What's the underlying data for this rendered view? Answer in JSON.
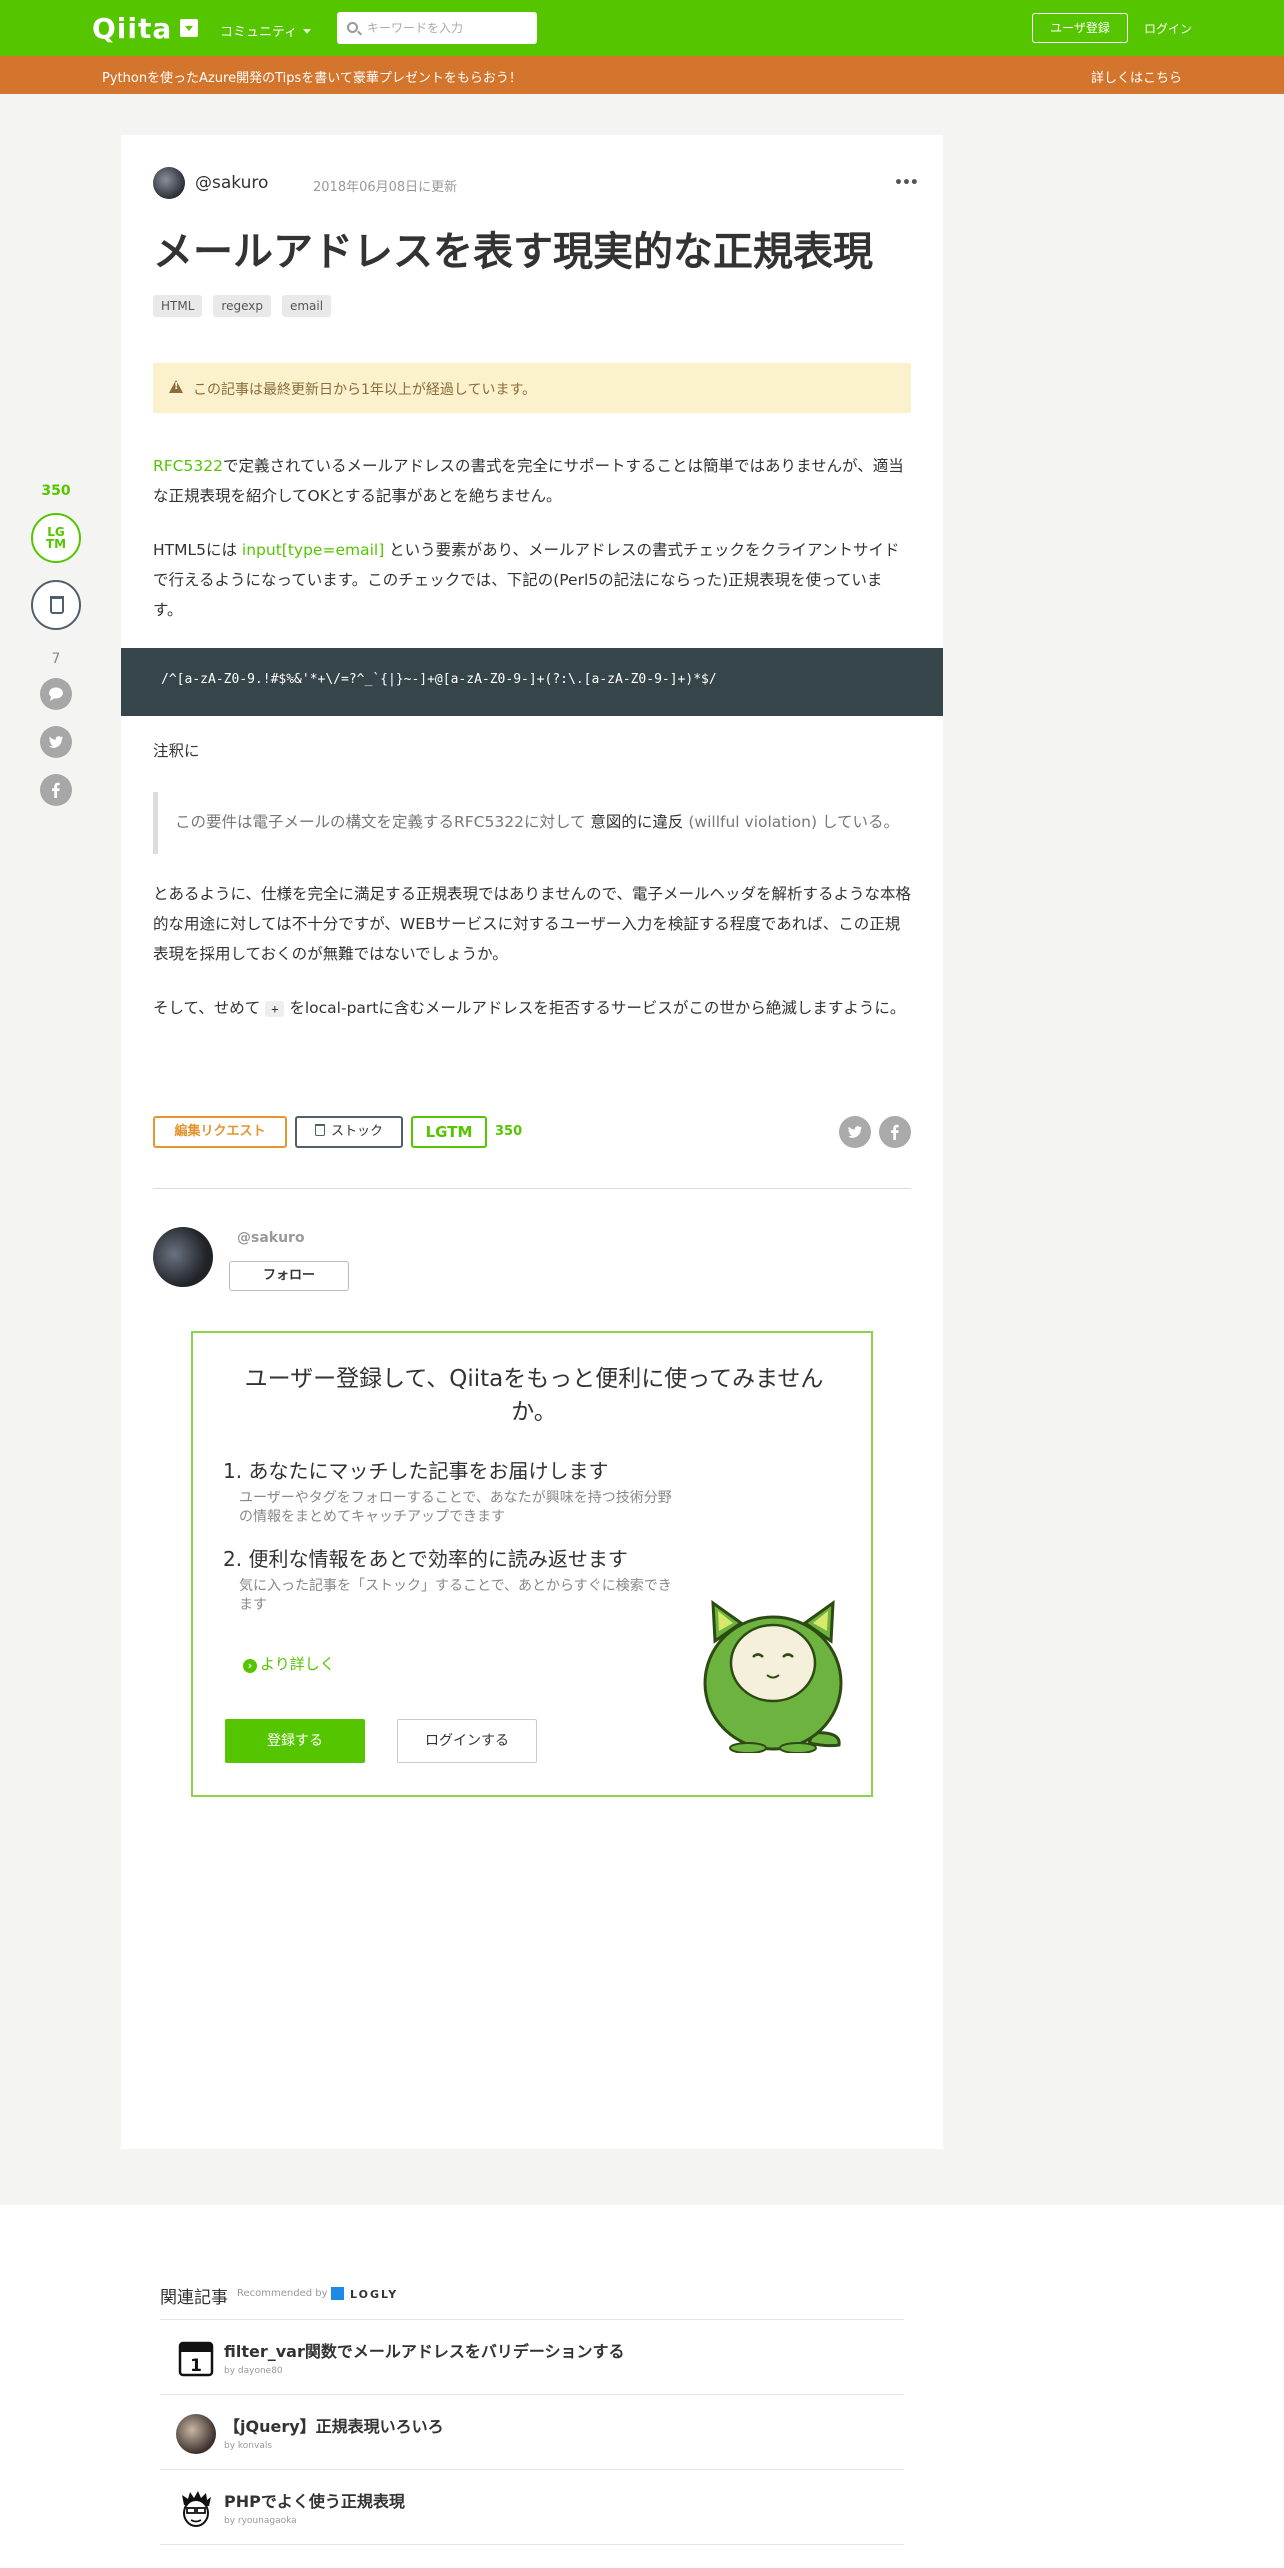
{
  "header": {
    "logo": "Qiita",
    "community": "コミュニティ",
    "search_placeholder": "キーワードを入力",
    "signup": "ユーザ登録",
    "login": "ログイン"
  },
  "banner": {
    "text": "Pythonを使ったAzure開発のTipsを書いて豪華プレゼントをもらおう！",
    "link": "詳しくはこちら"
  },
  "side": {
    "lgtm_count": "350",
    "lgtm_label": "LGTM",
    "comment_count": "7"
  },
  "article": {
    "author": "@sakuro",
    "date": "2018年06月08日に更新",
    "title": "メールアドレスを表す現実的な正規表現",
    "tags": [
      "HTML",
      "regexp",
      "email"
    ],
    "warning": "この記事は最終更新日から1年以上が経過しています。",
    "p1_link": "RFC5322",
    "p1_rest": "で定義されているメールアドレスの書式を完全にサポートすることは簡単ではありませんが、適当な正規表現を紹介してOKとする記事があとを絶ちません。",
    "p2_pre": "HTML5には ",
    "p2_link": "input[type=email]",
    "p2_rest": " という要素があり、メールアドレスの書式チェックをクライアントサイドで行えるようになっています。このチェックでは、下記の(Perl5の記法にならった)正規表現を使っています。",
    "code": "/^[a-zA-Z0-9.!#$%&'*+\\/=?^_`{|}~-]+@[a-zA-Z0-9-]+(?:\\.[a-zA-Z0-9-]+)*$/",
    "p3": "注釈に",
    "quote_pre": "この要件は電子メールの構文を定義するRFC5322に対して ",
    "quote_strong": "意図的に違反",
    "quote_post": " (willful violation) している。",
    "p4": "とあるように、仕様を完全に満足する正規表現ではありませんので、電子メールヘッダを解析するような本格的な用途に対しては不十分ですが、WEBサービスに対するユーザー入力を検証する程度であれば、この正規表現を採用しておくのが無難ではないでしょうか。",
    "p5_pre": "そして、せめて ",
    "p5_code": "+",
    "p5_rest": " をlocal-partに含むメールアドレスを拒否するサービスがこの世から絶滅しますように。"
  },
  "actions": {
    "edit": "編集リクエスト",
    "stock": "ストック",
    "lgtm": "LGTM",
    "lgtm_count": "350"
  },
  "author_box": {
    "name": "@sakuro",
    "follow": "フォロー"
  },
  "register": {
    "title": "ユーザー登録して、Qiitaをもっと便利に使ってみませんか。",
    "items": [
      {
        "heading": "1. あなたにマッチした記事をお届けします",
        "desc": "ユーザーやタグをフォローすることで、あなたが興味を持つ技術分野の情報をまとめてキャッチアップできます"
      },
      {
        "heading": "2. 便利な情報をあとで効率的に読み返せます",
        "desc": "気に入った記事を「ストック」することで、あとからすぐに検索できます"
      }
    ],
    "more": "より詳しく",
    "signup": "登録する",
    "login": "ログインする"
  },
  "related": {
    "heading": "関連記事",
    "recommended": "Recommended by",
    "brand": "LOGLY",
    "items": [
      {
        "title": "filter_var関数でメールアドレスをバリデーションする",
        "by": "by dayone80"
      },
      {
        "title": "【jQuery】正規表現いろいろ",
        "by": "by konvals"
      },
      {
        "title": "PHPでよく使う正規表現",
        "by": "by ryounagaoka"
      }
    ]
  }
}
